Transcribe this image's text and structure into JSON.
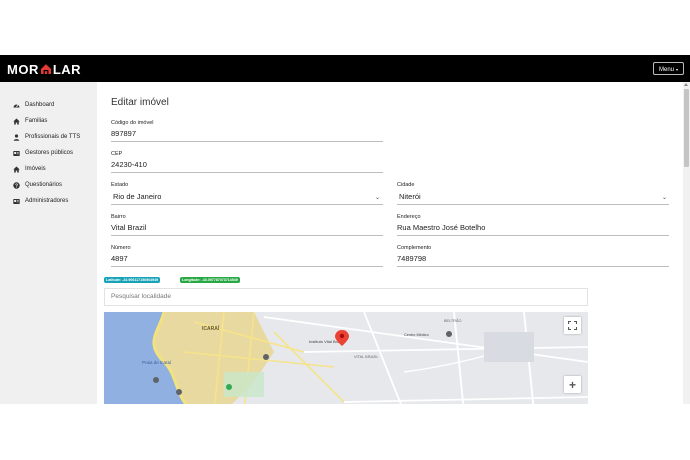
{
  "brand": {
    "part1": "MOR",
    "part2": "LAR"
  },
  "header": {
    "menu_label": "Menu",
    "menu_caret": "▾"
  },
  "sidebar": {
    "items": [
      {
        "label": "Dashboard",
        "icon": "dashboard-icon"
      },
      {
        "label": "Familias",
        "icon": "home-icon"
      },
      {
        "label": "Profissionais de TTS",
        "icon": "user-icon"
      },
      {
        "label": "Gestores públicos",
        "icon": "id-card-icon"
      },
      {
        "label": "Imóveis",
        "icon": "house-icon"
      },
      {
        "label": "Questionários",
        "icon": "question-icon"
      },
      {
        "label": "Administradores",
        "icon": "id-card-icon"
      }
    ]
  },
  "form": {
    "title": "Editar imóvel",
    "codigo": {
      "label": "Código do imóvel",
      "value": "897897"
    },
    "cep": {
      "label": "CEP",
      "value": "24230-410"
    },
    "estado": {
      "label": "Estado",
      "value": "Rio de Janeiro"
    },
    "cidade": {
      "label": "Cidade",
      "value": "Niterói"
    },
    "bairro": {
      "label": "Bairro",
      "value": "Vital Brazil"
    },
    "endereco": {
      "label": "Endereço",
      "value": "Rua Maestro José Botelho"
    },
    "numero": {
      "label": "Número",
      "value": "4897"
    },
    "complemento": {
      "label": "Complemento",
      "value": "7489798"
    }
  },
  "coords": {
    "latitude_badge": "Latitude: -22.906117156904949",
    "longitude_badge": "Longitude: -43.097787073714549"
  },
  "search": {
    "placeholder": "Pesquisar localidade"
  },
  "map": {
    "labels": {
      "icarai": "ICARAÍ",
      "praia": "Praia de Icaraí",
      "vital": "VITAL BRAZIL",
      "instituto": "Instituto Vital Brazil",
      "centro": "Centro Médico",
      "belford": "BELTRÃO"
    },
    "fullscreen_icon": "fullscreen-icon",
    "zoom_in": "+"
  },
  "colors": {
    "latitude_badge": "#17a2b8",
    "longitude_badge": "#28a745",
    "topbar": "#000000",
    "logo_accent": "#e53935",
    "map_pin": "#ea4335"
  }
}
